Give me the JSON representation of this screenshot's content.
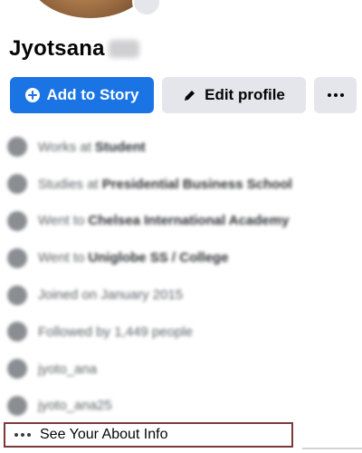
{
  "profile": {
    "name": "Jyotsana"
  },
  "actions": {
    "add_story_label": "Add to Story",
    "edit_profile_label": "Edit profile"
  },
  "info_rows": [
    {
      "prefix": "Works at",
      "value": "Student",
      "icon": "briefcase-icon"
    },
    {
      "prefix": "Studies at",
      "value": "Presidential Business School",
      "icon": "school-icon"
    },
    {
      "prefix": "Went to",
      "value": "Chelsea International Academy",
      "icon": "school-icon"
    },
    {
      "prefix": "Went to",
      "value": "Uniglobe SS / College",
      "icon": "school-icon"
    },
    {
      "prefix": "Joined on January 2015",
      "value": "",
      "icon": "clock-icon"
    },
    {
      "prefix": "Followed by 1,449 people",
      "value": "",
      "icon": "rss-icon"
    },
    {
      "prefix": "jyoto_ana",
      "value": "",
      "icon": "instagram-icon"
    },
    {
      "prefix": "jyoto_ana25",
      "value": "",
      "icon": "instagram-icon"
    }
  ],
  "about": {
    "label": "See Your About Info"
  },
  "colors": {
    "primary": "#1b74e4",
    "secondary_button": "#e4e6eb",
    "highlight_border": "#7a3a3a"
  }
}
